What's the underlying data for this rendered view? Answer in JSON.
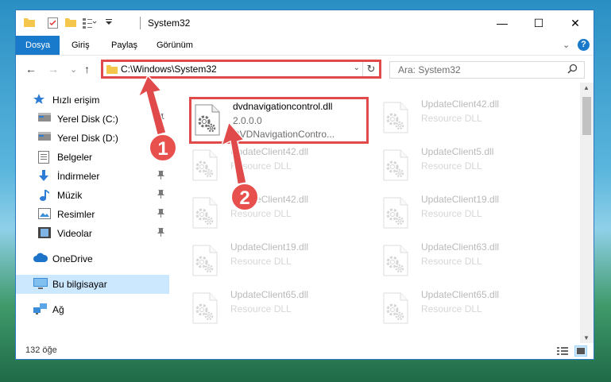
{
  "window": {
    "title": "System32",
    "controls": {
      "minimize": "—",
      "maximize": "☐",
      "close": "✕"
    }
  },
  "ribbon": {
    "tabs": [
      "Dosya",
      "Giriş",
      "Paylaş",
      "Görünüm"
    ],
    "help_icon": "?",
    "collapse_icon": "⌄"
  },
  "navbar": {
    "back": "←",
    "forward": "→",
    "recent": "⌄",
    "up": "↑",
    "address": "C:\\Windows\\System32",
    "refresh": "↻",
    "search_placeholder": "Ara: System32"
  },
  "sidebar": {
    "items": [
      {
        "label": "Hızlı erişim",
        "icon": "star-icon",
        "pinned": false
      },
      {
        "label": "Yerel Disk (C:)",
        "icon": "drive-icon",
        "pinned": true
      },
      {
        "label": "Yerel Disk (D:)",
        "icon": "drive-icon",
        "pinned": true
      },
      {
        "label": "Belgeler",
        "icon": "documents-icon",
        "pinned": true
      },
      {
        "label": "İndirmeler",
        "icon": "download-icon",
        "pinned": true
      },
      {
        "label": "Müzik",
        "icon": "music-icon",
        "pinned": true
      },
      {
        "label": "Resimler",
        "icon": "pictures-icon",
        "pinned": true
      },
      {
        "label": "Videolar",
        "icon": "videos-icon",
        "pinned": true
      },
      {
        "label": "OneDrive",
        "icon": "cloud-icon",
        "pinned": false
      },
      {
        "label": "Bu bilgisayar",
        "icon": "computer-icon",
        "pinned": false,
        "selected": true
      },
      {
        "label": "Ağ",
        "icon": "network-icon",
        "pinned": false
      }
    ],
    "pin_glyph": "📌"
  },
  "files": [
    {
      "name": "dvdnavigationcontrol.dll",
      "line2": "2.0.0.0",
      "line3": "DVDNavigationContro...",
      "highlight": true
    },
    {
      "name": "UpdateClient42.dll",
      "line2": "Resource DLL"
    },
    {
      "name": "UpdateClient42.dll",
      "line2": "Resource DLL"
    },
    {
      "name": "UpdateClient5.dll",
      "line2": "Resource DLL"
    },
    {
      "name": "UpdateClient42.dll",
      "line2": "Resource DLL"
    },
    {
      "name": "UpdateClient19.dll",
      "line2": "Resource DLL"
    },
    {
      "name": "UpdateClient19.dll",
      "line2": "Resource DLL"
    },
    {
      "name": "UpdateClient63.dll",
      "line2": "Resource DLL"
    },
    {
      "name": "UpdateClient65.dll",
      "line2": "Resource DLL"
    },
    {
      "name": "UpdateClient65.dll",
      "line2": "Resource DLL"
    }
  ],
  "status": {
    "count": "132 öğe"
  },
  "annotations": {
    "badge1": "1",
    "badge2": "2",
    "color": "#e04a4a"
  }
}
